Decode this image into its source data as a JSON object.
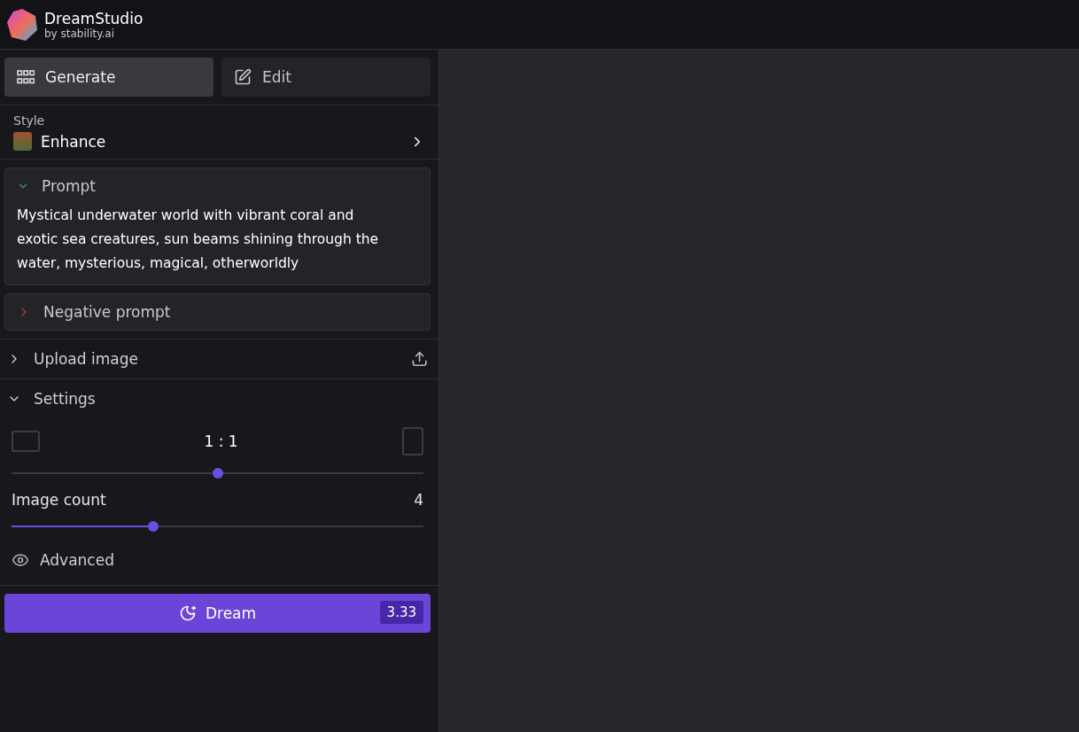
{
  "header": {
    "title": "DreamStudio",
    "subtitle": "by stability.ai"
  },
  "tabs": [
    {
      "label": "Generate",
      "kind": "grid",
      "selected": true
    },
    {
      "label": "Edit",
      "kind": "edit",
      "selected": false
    }
  ],
  "style": {
    "label": "Style",
    "value": "Enhance"
  },
  "prompts": [
    {
      "label": "Prompt",
      "expanded": true,
      "color": "#3f9a5a",
      "text": "Mystical underwater world with vibrant coral and exotic sea creatures, sun beams shining through the water, mysterious, magical, otherworldly"
    },
    {
      "label": "Negative prompt",
      "expanded": false,
      "color": "#b8343f"
    }
  ],
  "upload": {
    "label": "Upload image",
    "expanded": false
  },
  "settings": {
    "label": "Settings",
    "expanded": true,
    "aspect": {
      "value": "1 : 1",
      "level": 0.5
    },
    "image_count": {
      "label": "Image count",
      "value": "4",
      "level": 0.34
    },
    "advanced": "Advanced"
  },
  "dream": {
    "label": "Dream",
    "cost": "3.33"
  }
}
